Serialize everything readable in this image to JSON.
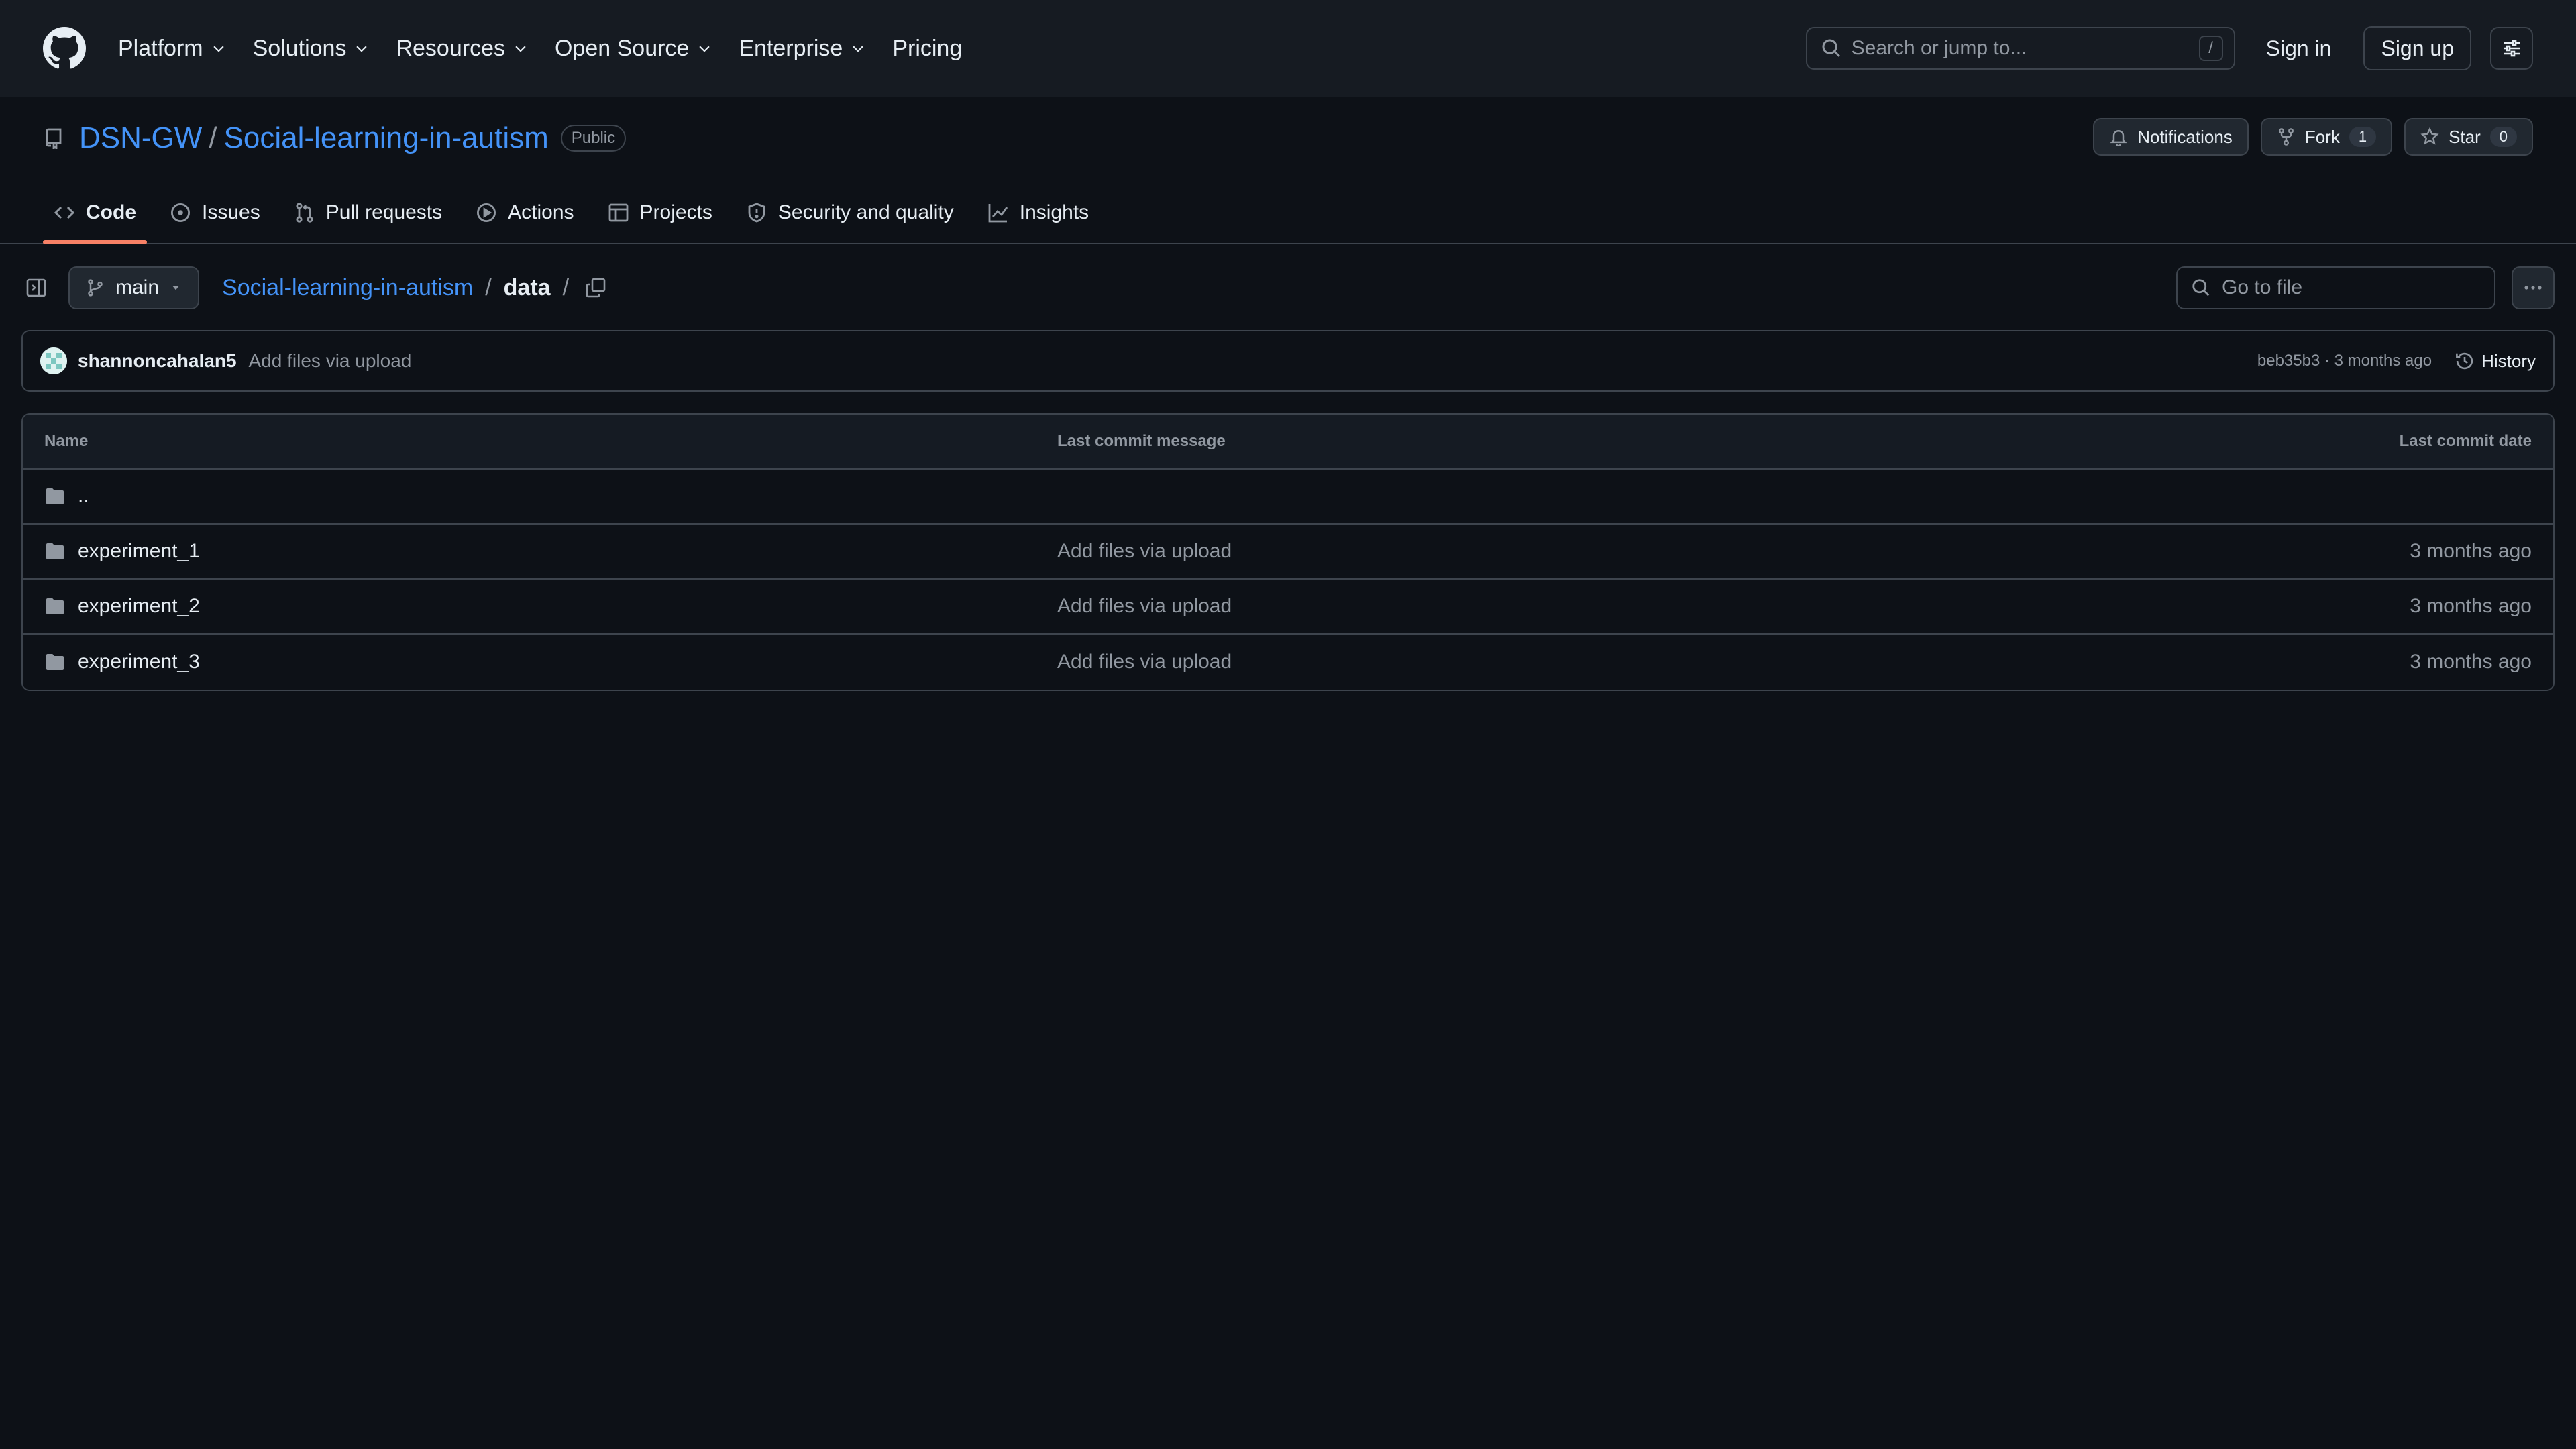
{
  "header": {
    "nav": [
      {
        "label": "Platform",
        "has_menu": true
      },
      {
        "label": "Solutions",
        "has_menu": true
      },
      {
        "label": "Resources",
        "has_menu": true
      },
      {
        "label": "Open Source",
        "has_menu": true
      },
      {
        "label": "Enterprise",
        "has_menu": true
      },
      {
        "label": "Pricing",
        "has_menu": false
      }
    ],
    "search_placeholder": "Search or jump to...",
    "search_shortcut": "/",
    "sign_in": "Sign in",
    "sign_up": "Sign up"
  },
  "repo": {
    "owner": "DSN-GW",
    "separator": "/",
    "name": "Social-learning-in-autism",
    "visibility": "Public",
    "notifications_label": "Notifications",
    "fork_label": "Fork",
    "fork_count": "1",
    "star_label": "Star",
    "star_count": "0"
  },
  "tabs": [
    {
      "label": "Code",
      "icon": "code-icon",
      "selected": true
    },
    {
      "label": "Issues",
      "icon": "issue-icon",
      "selected": false
    },
    {
      "label": "Pull requests",
      "icon": "pull-request-icon",
      "selected": false
    },
    {
      "label": "Actions",
      "icon": "play-icon",
      "selected": false
    },
    {
      "label": "Projects",
      "icon": "table-icon",
      "selected": false
    },
    {
      "label": "Security and quality",
      "icon": "shield-icon",
      "selected": false
    },
    {
      "label": "Insights",
      "icon": "graph-icon",
      "selected": false
    }
  ],
  "toolbar": {
    "branch": "main",
    "breadcrumb_repo": "Social-learning-in-autism",
    "breadcrumb_sep": "/",
    "breadcrumb_current": "data",
    "goto_placeholder": "Go to file"
  },
  "commit": {
    "author": "shannoncahalan5",
    "message": "Add files via upload",
    "meta": "beb35b3 · 3 months ago",
    "history_label": "History"
  },
  "table": {
    "headers": {
      "name": "Name",
      "message": "Last commit message",
      "date": "Last commit date"
    },
    "parent": "..",
    "rows": [
      {
        "name": "experiment_1",
        "message": "Add files via upload",
        "date": "3 months ago"
      },
      {
        "name": "experiment_2",
        "message": "Add files via upload",
        "date": "3 months ago"
      },
      {
        "name": "experiment_3",
        "message": "Add files via upload",
        "date": "3 months ago"
      }
    ]
  },
  "colors": {
    "background": "#0d1117",
    "header_bg": "#161b22",
    "link": "#4493f8",
    "border": "#3d444d",
    "tab_underline": "#f78166"
  }
}
